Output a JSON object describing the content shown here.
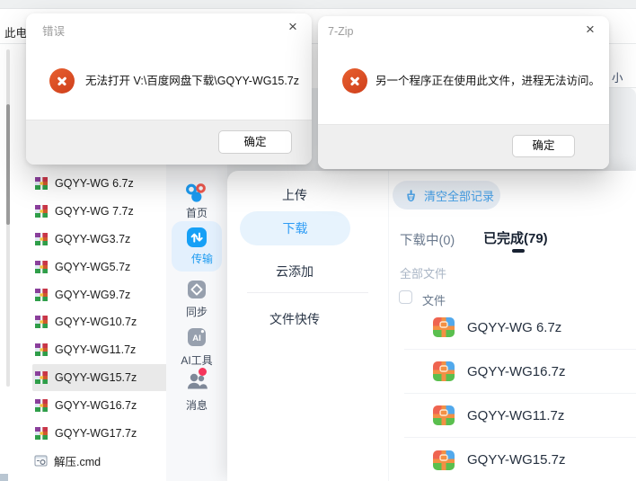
{
  "colors": {
    "accent_blue": "#2e9cf5",
    "error_icon_orange": "#d94f26",
    "badge_red": "#f5365c",
    "tab_active_dark": "#182232",
    "selected_row_gray": "#e9e9e9"
  },
  "explorer": {
    "tab_label": "此电",
    "size_column_partial": "小",
    "files": [
      {
        "name": "GQYY-WG 6.7z"
      },
      {
        "name": "GQYY-WG 7.7z"
      },
      {
        "name": "GQYY-WG3.7z"
      },
      {
        "name": "GQYY-WG5.7z"
      },
      {
        "name": "GQYY-WG9.7z"
      },
      {
        "name": "GQYY-WG10.7z"
      },
      {
        "name": "GQYY-WG11.7z"
      },
      {
        "name": "GQYY-WG15.7z",
        "selected": true
      },
      {
        "name": "GQYY-WG16.7z"
      },
      {
        "name": "GQYY-WG17.7z"
      },
      {
        "name": "解压.cmd"
      }
    ]
  },
  "error_dialog": {
    "title": "错误",
    "close_glyph": "×",
    "message": "无法打开 V:\\百度网盘下载\\GQYY-WG15.7z",
    "ok_label": "确定"
  },
  "sevenzip_dialog": {
    "title": "7-Zip",
    "close_glyph": "×",
    "message": "另一个程序正在使用此文件，进程无法访问。",
    "ok_label": "确定"
  },
  "netdisk": {
    "sidebar": [
      {
        "label": "首页"
      },
      {
        "label": "传输",
        "active": true
      },
      {
        "label": "同步"
      },
      {
        "label": "AI工具",
        "icon_text": "AI"
      },
      {
        "label": "消息",
        "has_badge": true
      }
    ],
    "transfer_nav": {
      "upload": "上传",
      "download": "下载",
      "cloud_add": "云添加",
      "quick_transfer": "文件快传"
    },
    "records": {
      "clear_button": "清空全部记录",
      "tab_downloading": "下载中(0)",
      "tab_completed": "已完成(79)",
      "filter": "全部文件",
      "header": "文件",
      "items": [
        {
          "name": "GQYY-WG 6.7z"
        },
        {
          "name": "GQYY-WG16.7z"
        },
        {
          "name": "GQYY-WG11.7z"
        },
        {
          "name": "GQYY-WG15.7z"
        }
      ]
    }
  }
}
